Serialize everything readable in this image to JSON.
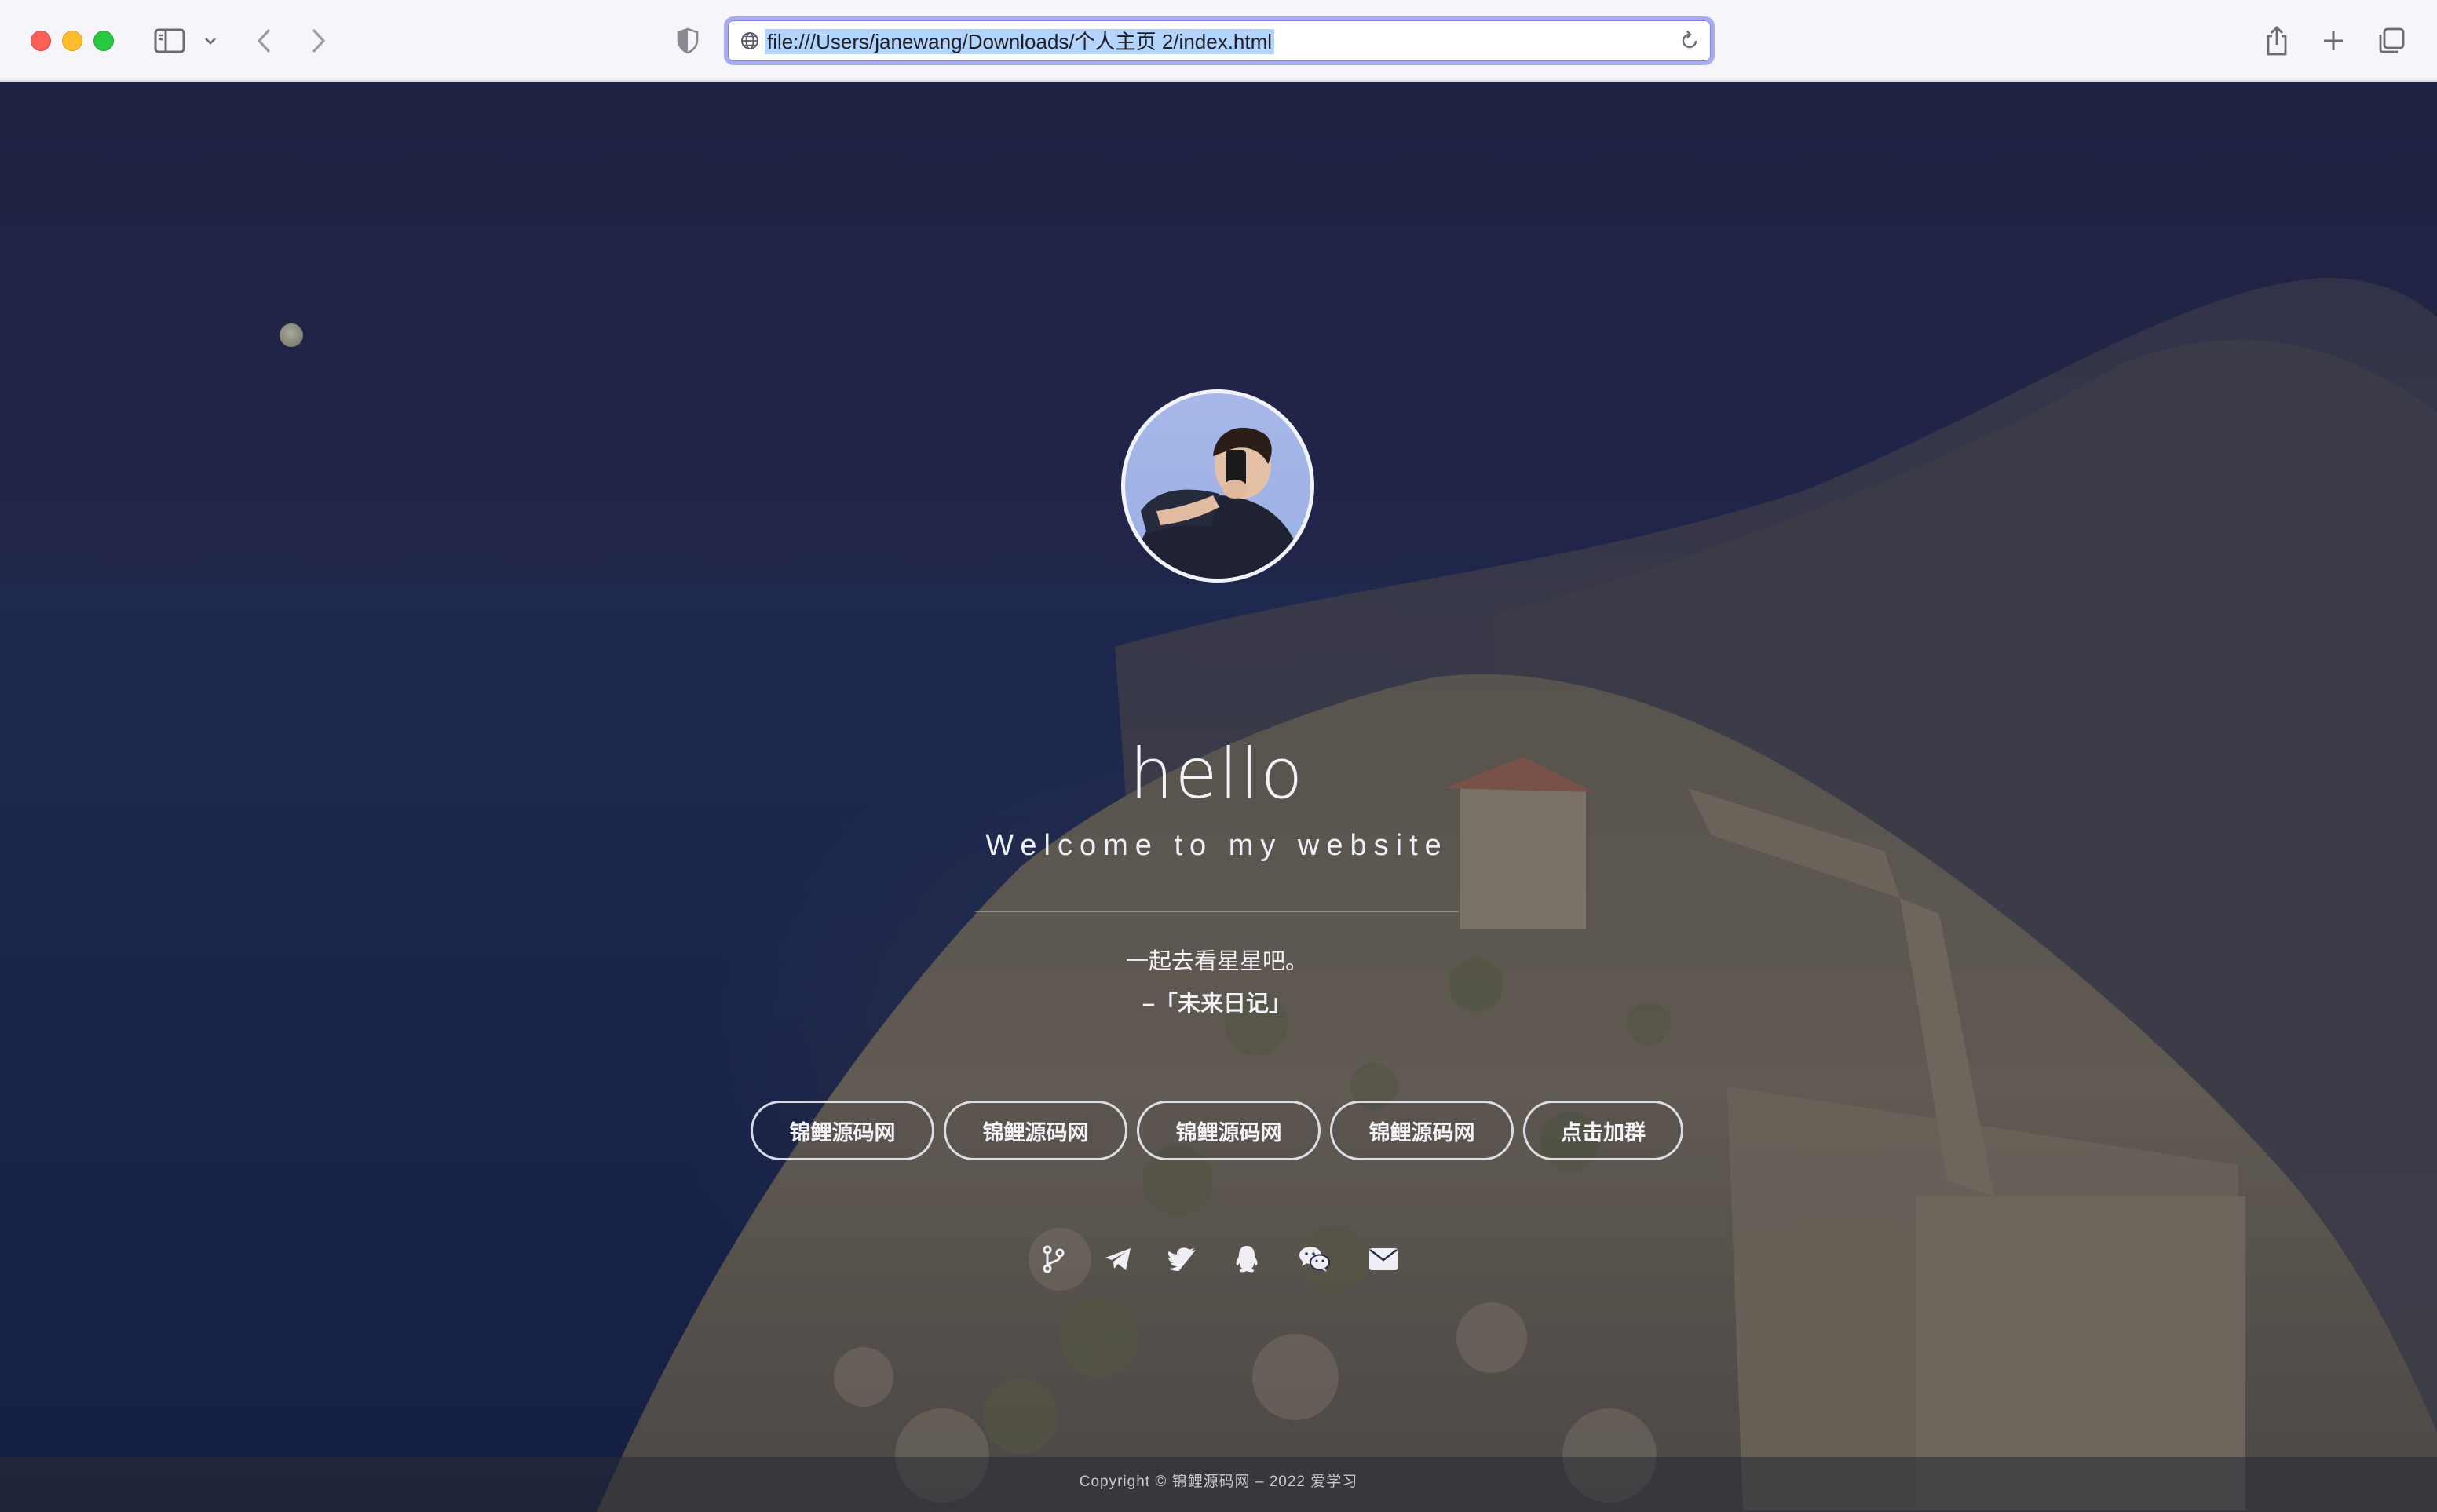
{
  "browser": {
    "url": "file:///Users/janewang/Downloads/个人主页 2/index.html"
  },
  "profile": {
    "greeting": "hello",
    "welcome": "Welcome to my website",
    "quote": "一起去看星星吧。",
    "quote_source": "–「未来日记」"
  },
  "buttons": [
    {
      "label": "锦鲤源码网"
    },
    {
      "label": "锦鲤源码网"
    },
    {
      "label": "锦鲤源码网"
    },
    {
      "label": "锦鲤源码网"
    },
    {
      "label": "点击加群"
    }
  ],
  "social_icons": [
    "git-branch-icon",
    "telegram-icon",
    "twitter-icon",
    "qq-icon",
    "wechat-icon",
    "email-icon"
  ],
  "footer": {
    "copyright": "Copyright © 锦鲤源码网 – 2022 爱学习"
  },
  "colors": {
    "url_focus_ring": "#a9abf0",
    "url_selection": "#b3d4fc",
    "night_sky": "#232546"
  }
}
